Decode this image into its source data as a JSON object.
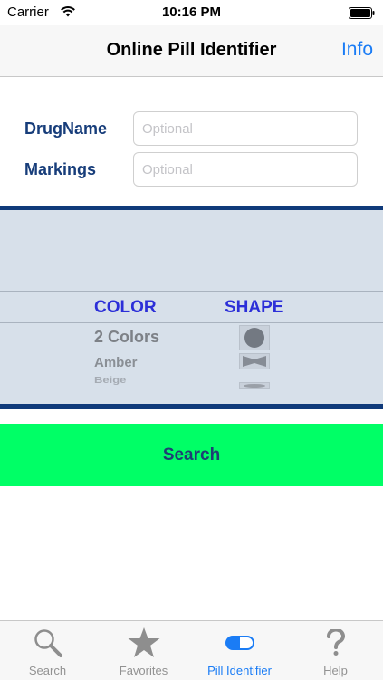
{
  "status_bar": {
    "carrier": "Carrier",
    "time": "10:16 PM"
  },
  "nav": {
    "title": "Online Pill Identifier",
    "info_label": "Info"
  },
  "form": {
    "drug_name": {
      "label": "DrugName",
      "placeholder": "Optional",
      "value": ""
    },
    "markings": {
      "label": "Markings",
      "placeholder": "Optional",
      "value": ""
    }
  },
  "picker": {
    "color_header": "COLOR",
    "shape_header": "SHAPE",
    "color_options": [
      "2 Colors",
      "Amber",
      "Beige"
    ]
  },
  "search": {
    "label": "Search",
    "color": "#00ff66"
  },
  "tabs": [
    {
      "label": "Search",
      "icon": "magnifier-icon"
    },
    {
      "label": "Favorites",
      "icon": "star-icon"
    },
    {
      "label": "Pill Identifier",
      "icon": "pill-icon"
    },
    {
      "label": "Help",
      "icon": "question-icon"
    }
  ],
  "active_tab": "Pill Identifier",
  "colors": {
    "accent": "#1a7cf5",
    "label_navy": "#173d7a",
    "picker_header": "#2c2fd8"
  }
}
